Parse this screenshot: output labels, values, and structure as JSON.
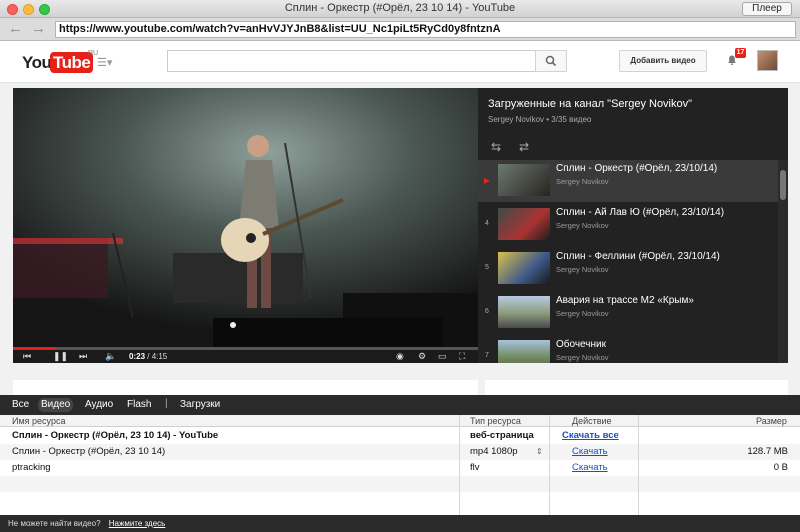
{
  "window": {
    "title": "Сплин - Оркестр (#Орёл, 23 10 14) - YouTube",
    "player_button": "Плеер"
  },
  "address": {
    "url": "https://www.youtube.com/watch?v=anHvVJYJnB8&list=UU_Nc1piLt5RyCd0y8fntznA"
  },
  "youtube": {
    "logo_you": "You",
    "logo_tube": "Tube",
    "logo_region": "RU",
    "upload_label": "Добавить видео",
    "notifications": "17"
  },
  "player": {
    "current_time": "0:23",
    "duration": "4:15",
    "progress": 0.09
  },
  "playlist": {
    "title": "Загруженные на канал \"Sergey Novikov\"",
    "subtitle": "Sergey Novikov • 3/35 видео",
    "items": [
      {
        "num": "▶",
        "title": "Сплин - Оркестр (#Орёл, 23/10/14)",
        "author": "Sergey Novikov"
      },
      {
        "num": "4",
        "title": "Сплин - Ай Лав Ю (#Орёл, 23/10/14)",
        "author": "Sergey Novikov"
      },
      {
        "num": "5",
        "title": "Сплин - Феллини (#Орёл, 23/10/14)",
        "author": "Sergey Novikov"
      },
      {
        "num": "6",
        "title": "Авария на трассе М2 «Крым»",
        "author": "Sergey Novikov"
      },
      {
        "num": "7",
        "title": "Обочечник",
        "author": "Sergey Novikov"
      }
    ]
  },
  "downloader": {
    "tabs": [
      "Все",
      "Видео",
      "Аудио",
      "Flash",
      "Загрузки"
    ],
    "selected_tab": "Видео",
    "columns": {
      "name": "Имя ресурса",
      "type": "Тип ресурса",
      "action": "Действие",
      "size": "Размер"
    },
    "rows": [
      {
        "name": "Сплин - Оркестр (#Орёл, 23 10 14) - YouTube",
        "type": "веб-страница",
        "action": "Скачать все",
        "size": ""
      },
      {
        "name": "Сплин - Оркестр (#Орёл, 23 10 14)",
        "type": "mp4 1080p",
        "action": "Скачать",
        "size": "128.7 MB"
      },
      {
        "name": "ptracking",
        "type": "flv",
        "action": "Скачать",
        "size": "0 B"
      }
    ],
    "footer_text": "Не можете найти видео?",
    "footer_link": "Нажмите здесь"
  },
  "colors": {
    "youtube_red": "#e62117",
    "link_blue": "#1a4fc6",
    "panel_dark": "#2a2a2a"
  }
}
